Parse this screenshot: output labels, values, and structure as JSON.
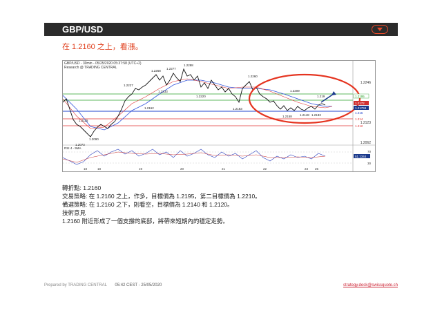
{
  "header": {
    "title": "GBP/USD"
  },
  "headline": "在  1.2160 之上，看漲。",
  "chart": {
    "caption_line1": "GBP/USD - 30min - 05/25/2020 05:37:58 (UTC+2)",
    "caption_line2": "Research @ TRADING CENTRAL",
    "price_ticks": [
      "1.2246",
      "1.2123",
      "1.2062"
    ],
    "right_badges": [
      "1.2195",
      "1.2172",
      "1.21759",
      "1.216",
      "1.214",
      "1.212"
    ],
    "rsi_label": "RSI 4 - 9MA",
    "rsi_ticks": [
      "70",
      "30"
    ],
    "rsi_badge": "51.1344",
    "x_labels": [
      "18",
      "18",
      "19",
      "20",
      "21",
      "22",
      "23",
      "25"
    ],
    "annotations": [
      "1.2227",
      "1.2268",
      "1.2277",
      "1.2288",
      "1.2233",
      "1.2260",
      "1.2209",
      "1.2162",
      "1.2220",
      "1.2183",
      "1.2158",
      "1.2183",
      "1.2115",
      "1.2090",
      "1.2073",
      "1.2148",
      "1.219"
    ]
  },
  "body": {
    "pivot": "轉折點: 1.2160",
    "strategy": "交易策略: 在 1.2160 之上，作多，目標價為 1.2195，第二目標價為 1.2210。",
    "alternative": "備選策略: 在 1.2160 之下，則看空，目標價為 1.2140 和 1.2120。",
    "comment_title": "技術意見",
    "comment": "1.2160 附近形成了一個支撐的底部，將帶來短期內的穩定走勢。"
  },
  "footer": {
    "prepared": "Prepared by TRADING CENTRAL",
    "timestamp": "05:42 CEST - 25/05/2020",
    "email": "strategy.desk@swissquote.ch"
  },
  "colors": {
    "header_bg": "#2b2b2b",
    "accent": "#e84a2a",
    "headline": "#e0401e"
  }
}
